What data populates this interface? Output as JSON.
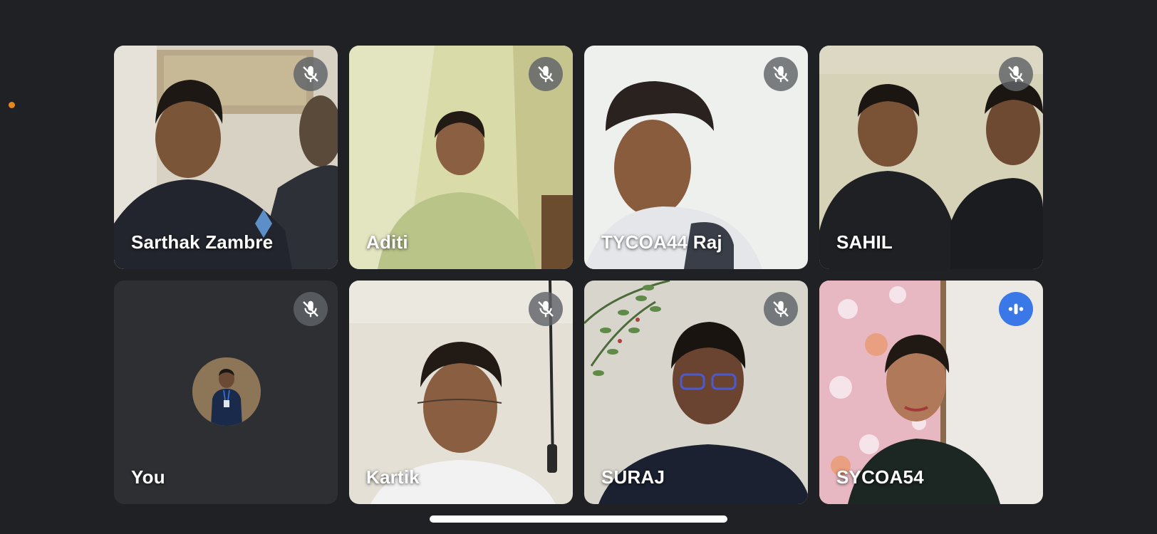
{
  "participants": [
    {
      "name": "Sarthak Zambre",
      "mic": "muted"
    },
    {
      "name": "Aditi",
      "mic": "muted"
    },
    {
      "name": "TYCOA44 Raj",
      "mic": "muted"
    },
    {
      "name": "SAHIL",
      "mic": "muted"
    },
    {
      "name": "You",
      "mic": "muted"
    },
    {
      "name": "Kartik",
      "mic": "muted"
    },
    {
      "name": "SURAJ",
      "mic": "muted"
    },
    {
      "name": "SYCOA54",
      "mic": "speaking"
    }
  ],
  "colors": {
    "background": "#202124",
    "muted_badge": "#5f6368",
    "speaking_badge": "#3b78e7",
    "status_dot": "#e8871e"
  },
  "icons": {
    "muted": "mic-off-icon",
    "speaking": "audio-level-icon"
  }
}
